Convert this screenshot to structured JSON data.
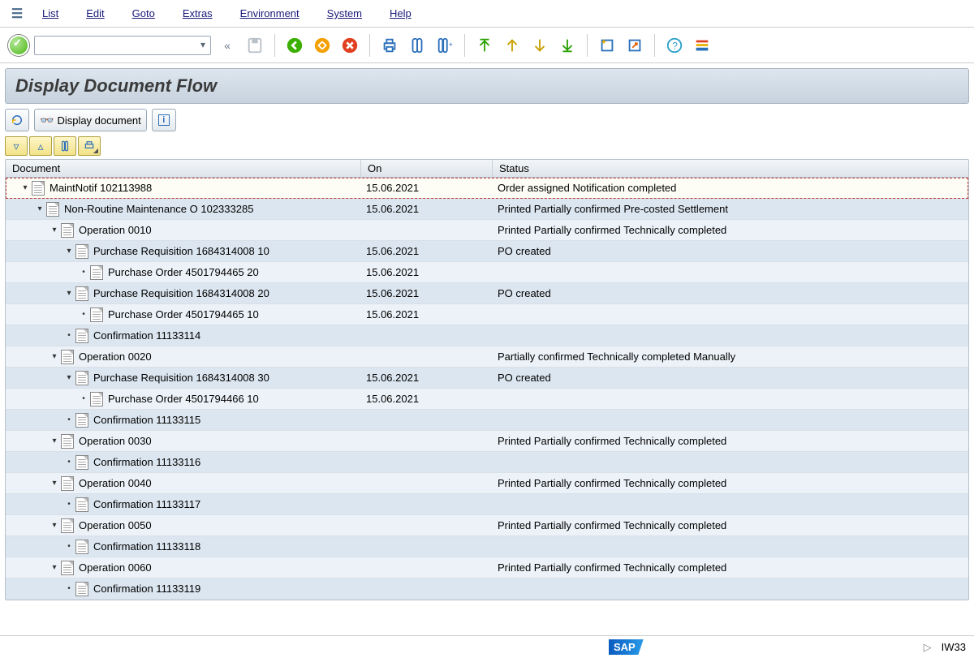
{
  "menu": {
    "list": "List",
    "edit": "Edit",
    "goto": "Goto",
    "extras": "Extras",
    "environment": "Environment",
    "system": "System",
    "help": "Help"
  },
  "title": "Display Document Flow",
  "apptoolbar": {
    "display_doc": "Display document"
  },
  "columns": {
    "document": "Document",
    "on": "On",
    "status": "Status"
  },
  "rows": [
    {
      "depth": 0,
      "twisty": "▾",
      "label": "MaintNotif 102113988",
      "on": "15.06.2021",
      "status": "Order assigned Notification completed",
      "sel": true
    },
    {
      "depth": 1,
      "twisty": "▾",
      "label": "Non-Routine Maintenance O 102333285",
      "on": "15.06.2021",
      "status": "Printed Partially confirmed Pre-costed Settlement"
    },
    {
      "depth": 2,
      "twisty": "▾",
      "label": "Operation 0010",
      "on": "",
      "status": "Printed Partially confirmed Technically completed"
    },
    {
      "depth": 3,
      "twisty": "▾",
      "label": "Purchase Requisition 1684314008 10",
      "on": "15.06.2021",
      "status": "PO created"
    },
    {
      "depth": 4,
      "twisty": "•",
      "label": "Purchase Order 4501794465 20",
      "on": "15.06.2021",
      "status": ""
    },
    {
      "depth": 3,
      "twisty": "▾",
      "label": "Purchase Requisition 1684314008 20",
      "on": "15.06.2021",
      "status": "PO created"
    },
    {
      "depth": 4,
      "twisty": "•",
      "label": "Purchase Order 4501794465 10",
      "on": "15.06.2021",
      "status": ""
    },
    {
      "depth": 3,
      "twisty": "•",
      "label": "Confirmation 11133114",
      "on": "",
      "status": ""
    },
    {
      "depth": 2,
      "twisty": "▾",
      "label": "Operation 0020",
      "on": "",
      "status": "Partially confirmed Technically completed Manually"
    },
    {
      "depth": 3,
      "twisty": "▾",
      "label": "Purchase Requisition 1684314008 30",
      "on": "15.06.2021",
      "status": "PO created"
    },
    {
      "depth": 4,
      "twisty": "•",
      "label": "Purchase Order 4501794466 10",
      "on": "15.06.2021",
      "status": ""
    },
    {
      "depth": 3,
      "twisty": "•",
      "label": "Confirmation 11133115",
      "on": "",
      "status": ""
    },
    {
      "depth": 2,
      "twisty": "▾",
      "label": "Operation 0030",
      "on": "",
      "status": "Printed Partially confirmed Technically completed"
    },
    {
      "depth": 3,
      "twisty": "•",
      "label": "Confirmation 11133116",
      "on": "",
      "status": ""
    },
    {
      "depth": 2,
      "twisty": "▾",
      "label": "Operation 0040",
      "on": "",
      "status": "Printed Partially confirmed Technically completed"
    },
    {
      "depth": 3,
      "twisty": "•",
      "label": "Confirmation 11133117",
      "on": "",
      "status": ""
    },
    {
      "depth": 2,
      "twisty": "▾",
      "label": "Operation 0050",
      "on": "",
      "status": "Printed Partially confirmed Technically completed"
    },
    {
      "depth": 3,
      "twisty": "•",
      "label": "Confirmation 11133118",
      "on": "",
      "status": ""
    },
    {
      "depth": 2,
      "twisty": "▾",
      "label": "Operation 0060",
      "on": "",
      "status": "Printed Partially confirmed Technically completed"
    },
    {
      "depth": 3,
      "twisty": "•",
      "label": "Confirmation 11133119",
      "on": "",
      "status": ""
    }
  ],
  "footer": {
    "tcode": "IW33"
  }
}
